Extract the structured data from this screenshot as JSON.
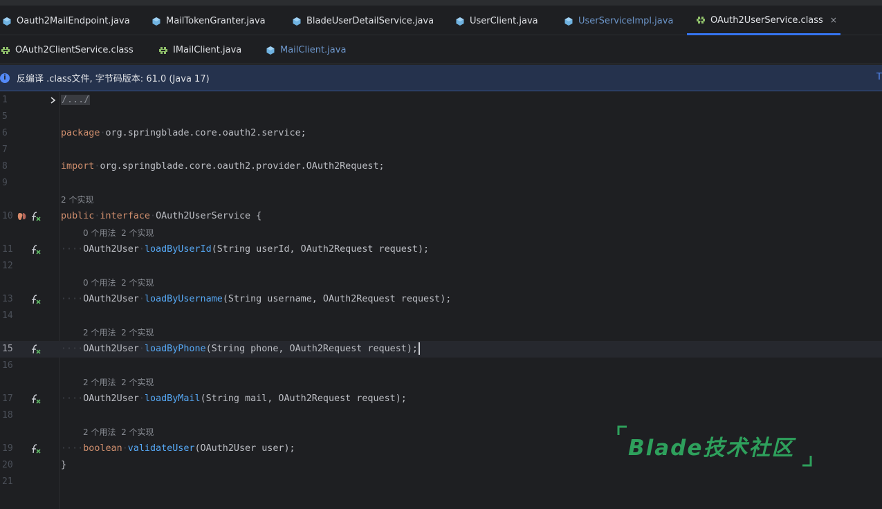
{
  "tabs_row1": [
    {
      "label": "Oauth2MailEndpoint.java",
      "icon": "java-interface-icon",
      "muted": false,
      "active": false
    },
    {
      "label": "MailTokenGranter.java",
      "icon": "java-interface-icon",
      "muted": false,
      "active": false
    },
    {
      "label": "BladeUserDetailService.java",
      "icon": "java-interface-icon",
      "muted": false,
      "active": false
    },
    {
      "label": "UserClient.java",
      "icon": "java-interface-icon",
      "muted": false,
      "active": false
    },
    {
      "label": "UserServiceImpl.java",
      "icon": "java-interface-icon",
      "muted": true,
      "active": false
    },
    {
      "label": "OAuth2UserService.class",
      "icon": "class-file-icon",
      "muted": false,
      "active": true,
      "close": "×"
    }
  ],
  "tabs_row2": [
    {
      "label": "OAuth2ClientService.class",
      "icon": "class-file-icon",
      "muted": false
    },
    {
      "label": "IMailClient.java",
      "icon": "class-file-icon",
      "muted": false
    },
    {
      "label": "MailClient.java",
      "icon": "java-interface-icon",
      "muted": true
    }
  ],
  "banner": {
    "text": "反编译 .class文件, 字节码版本: 61.0 (Java 17)",
    "link": "T"
  },
  "code": {
    "line_numbers": [
      "1",
      "5",
      "6",
      "7",
      "8",
      "9",
      "10",
      "11",
      "12",
      "13",
      "14",
      "15",
      "16",
      "17",
      "18",
      "19",
      "20",
      "21"
    ],
    "fold_text": "/.../",
    "package_kw": "package",
    "package_name": "org.springblade.core.oauth2.service;",
    "import_kw": "import",
    "import_name": "org.springblade.core.oauth2.provider.OAuth2Request;",
    "interface_hint": "2 个实现",
    "public_kw": "public",
    "interface_kw": "interface",
    "interface_name": "OAuth2UserService {",
    "indent": "····",
    "methods": [
      {
        "hint": "0 个用法  2 个实现",
        "type": "OAuth2User",
        "name": "loadByUserId",
        "params": "(String userId, OAuth2Request request);"
      },
      {
        "hint": "0 个用法  2 个实现",
        "type": "OAuth2User",
        "name": "loadByUsername",
        "params": "(String username, OAuth2Request request);"
      },
      {
        "hint": "2 个用法  2 个实现",
        "type": "OAuth2User",
        "name": "loadByPhone",
        "params": "(String phone, OAuth2Request request);"
      },
      {
        "hint": "2 个用法  2 个实现",
        "type": "OAuth2User",
        "name": "loadByMail",
        "params": "(String mail, OAuth2Request request);"
      },
      {
        "hint": "2 个用法  2 个实现",
        "type": "boolean",
        "name": "validateUser",
        "params": "(OAuth2User user);"
      }
    ],
    "closing_brace": "}"
  },
  "watermark": {
    "text": "Blade技术社区"
  },
  "colors": {
    "background": "#1e1f22",
    "keyword": "#cf8e6d",
    "function": "#56a8f5",
    "accent": "#3574f0",
    "watermark": "#2ea05c"
  }
}
